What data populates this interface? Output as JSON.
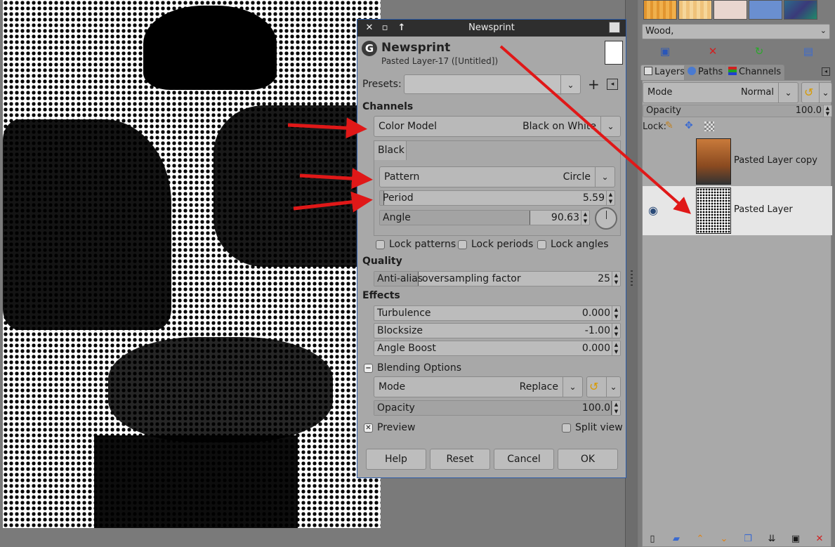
{
  "dialog": {
    "window_title": "Newsprint",
    "header_title": "Newsprint",
    "header_subtitle": "Pasted Layer-17 ([Untitled])",
    "presets_label": "Presets:",
    "presets_value": "",
    "channels_heading": "Channels",
    "color_model_label": "Color Model",
    "color_model_value": "Black on White",
    "channel_tab": "Black",
    "pattern_label": "Pattern",
    "pattern_value": "Circle",
    "period_label": "Period",
    "period_value": "5.59",
    "angle_label": "Angle",
    "angle_value": "90.63",
    "lock_patterns": "Lock patterns",
    "lock_periods": "Lock periods",
    "lock_angles": "Lock angles",
    "quality_heading": "Quality",
    "antialias_label": "Anti-alias",
    "oversampling_label": "oversampling factor",
    "oversampling_value": "25",
    "effects_heading": "Effects",
    "turbulence_label": "Turbulence",
    "turbulence_value": "0.000",
    "blocksize_label": "Blocksize",
    "blocksize_value": "-1.00",
    "angle_boost_label": "Angle Boost",
    "angle_boost_value": "0.000",
    "blending_heading": "Blending Options",
    "mode_label": "Mode",
    "mode_value": "Replace",
    "opacity_label": "Opacity",
    "opacity_value": "100.0",
    "preview_label": "Preview",
    "preview_checked": true,
    "split_view_label": "Split view",
    "buttons": {
      "help": "Help",
      "reset": "Reset",
      "cancel": "Cancel",
      "ok": "OK"
    }
  },
  "patterns": {
    "selected_name": "Wood,",
    "swatches": [
      "#e8a640",
      "#f0c070",
      "#e9d6cf",
      "#6a8fd0",
      "#2d6a8a"
    ]
  },
  "layers": {
    "tabs": [
      "Layers",
      "Paths",
      "Channels"
    ],
    "mode_label": "Mode",
    "mode_value": "Normal",
    "opacity_label": "Opacity",
    "opacity_value": "100.0",
    "lock_label": "Lock:",
    "items": [
      {
        "name": "Pasted Layer copy",
        "visible": false
      },
      {
        "name": "Pasted Layer",
        "visible": true
      }
    ]
  },
  "colors": {
    "arrow": "#e01818",
    "dialog_border": "#2a5aa8",
    "selected_layer": "#e6e6e6"
  }
}
